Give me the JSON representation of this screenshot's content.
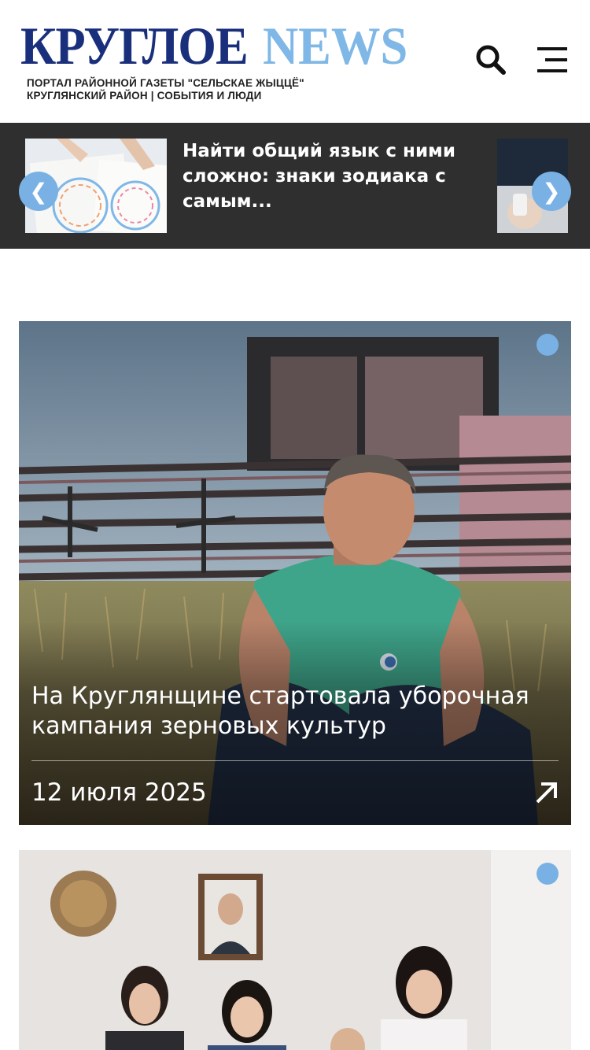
{
  "header": {
    "logo_part1": "КРУГЛОЕ",
    "logo_part2": "NEWS",
    "logo_sub_line1": "ПОРТАЛ РАЙОННОЙ ГАЗЕТЫ \"СЕЛЬСКАЕ ЖЫЦЦЁ\"",
    "logo_sub_line2": "КРУГЛЯНСКИЙ РАЙОН | СОБЫТИЯ И ЛЮДИ",
    "search_icon": "search-icon",
    "menu_icon": "menu-icon"
  },
  "ticker": {
    "title": "Найти общий язык с ними сложно: знаки зодиака с самым...",
    "prev_label": "❮",
    "next_label": "❯"
  },
  "articles": [
    {
      "title": "На Круглянщине стартовала уборочная кампания зерновых культур",
      "date": "12 июля 2025"
    }
  ],
  "colors": {
    "brand_dark": "#1a2f7c",
    "brand_light": "#7fb7e6",
    "accent": "#79b1e5",
    "ticker_bg": "#2f2f2f"
  }
}
